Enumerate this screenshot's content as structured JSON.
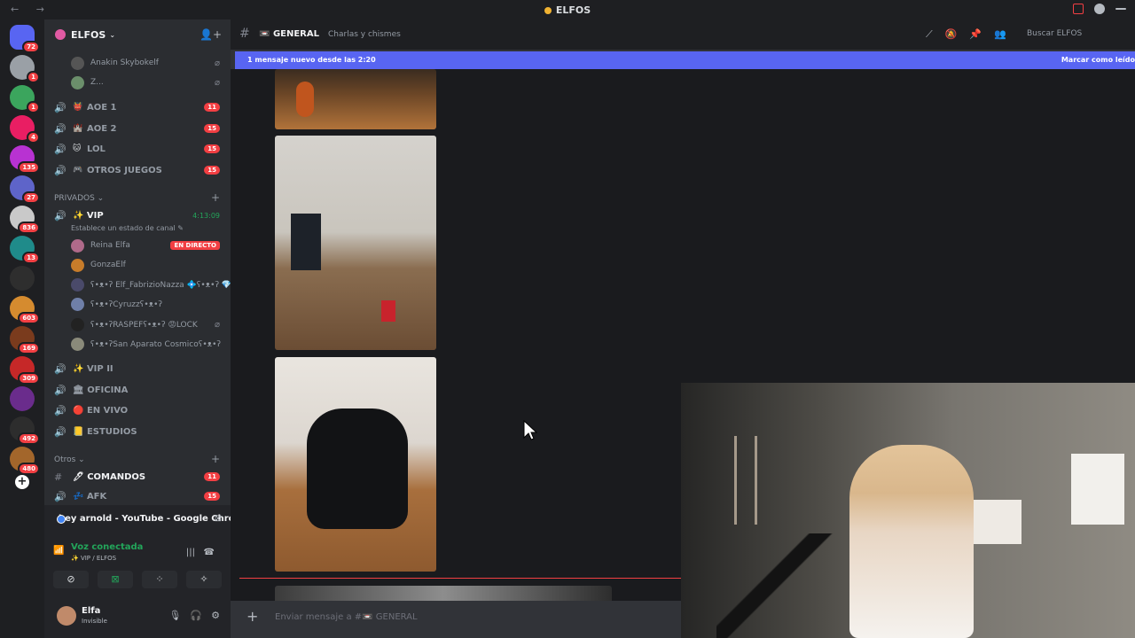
{
  "window": {
    "title": "ELFOS"
  },
  "guilds": [
    {
      "badge": "72",
      "color": "#5865f2"
    },
    {
      "badge": "1",
      "color": "#9aa0a6"
    },
    {
      "badge": "1",
      "color": "#3ba55d"
    },
    {
      "badge": "4",
      "color": "#e91e63"
    },
    {
      "badge": "135",
      "color": "#b832d2"
    },
    {
      "badge": "27",
      "color": "#5e64c9"
    },
    {
      "badge": "836",
      "color": "#c9c9c9"
    },
    {
      "badge": "13",
      "color": "#1f8b8a"
    },
    {
      "badge": "",
      "color": "#2e2e2e"
    },
    {
      "badge": "603",
      "color": "#d58b2f"
    },
    {
      "badge": "169",
      "color": "#7a3b1d"
    },
    {
      "badge": "309",
      "color": "#c62828"
    },
    {
      "badge": "",
      "color": "#6a2c8c"
    },
    {
      "badge": "492",
      "color": "#2d2d2d"
    },
    {
      "badge": "480",
      "color": "#a3662b"
    }
  ],
  "server": {
    "name": "ELFOS",
    "chevron": "⌄"
  },
  "top_users": [
    {
      "name": "Anakin Skybokelf",
      "color": "#555"
    },
    {
      "name": "Z...",
      "color": "#6b8f6b"
    }
  ],
  "voice_channels": [
    {
      "icon": "🔊",
      "emoji": "👹",
      "name": "AOE 1",
      "badge": "11"
    },
    {
      "icon": "🔊",
      "emoji": "🏰",
      "name": "AOE 2",
      "badge": "15"
    },
    {
      "icon": "🔊",
      "emoji": "🐱",
      "name": "LOL",
      "badge": "15"
    },
    {
      "icon": "🔊",
      "emoji": "🎮",
      "name": "OTROS JUEGOS",
      "badge": "15"
    }
  ],
  "privados": {
    "label": "PRIVADOS",
    "vip": {
      "name": "✨ VIP",
      "time": "4:13:09",
      "status": "Establece un estado de canal ✎"
    },
    "users": [
      {
        "name": "Reina Elfa",
        "color": "#b06a8a",
        "live": "EN DIRECTO"
      },
      {
        "name": "GonzaElf",
        "color": "#c77c2a",
        "live": ""
      },
      {
        "name": "ʕ•ᴥ•ʔ Elf_FabrizioNazza 💠ʕ•ᴥ•ʔ 💎",
        "color": "#4a4a6a",
        "live": ""
      },
      {
        "name": "ʕ•ᴥ•ʔCyruzzʕ•ᴥ•ʔ",
        "color": "#6f7fa8",
        "live": ""
      },
      {
        "name": "ʕ•ᴥ•ʔRASPEFʕ•ᴥ•ʔ 😡LOCK",
        "color": "#222",
        "live": ""
      },
      {
        "name": "ʕ•ᴥ•ʔSan Aparato Cosmicoʕ•ᴥ•ʔ",
        "color": "#8a8a7a",
        "live": ""
      }
    ],
    "channels": [
      {
        "emoji": "✨",
        "name": "VIP II"
      },
      {
        "emoji": "🏛",
        "name": "OFICINA"
      },
      {
        "emoji": "🔴",
        "name": "EN VIVO"
      },
      {
        "emoji": "📒",
        "name": "ESTUDIOS"
      }
    ]
  },
  "otros": {
    "label": "Otros",
    "channels": [
      {
        "name": "COMANDOS",
        "badge": "11",
        "emoji": "🖊"
      },
      {
        "name": "AFK",
        "badge": "15",
        "emoji": "💤"
      }
    ]
  },
  "activity": {
    "text": "hey arnold - YouTube - Google Chro..."
  },
  "voice": {
    "title": "Voz conectada",
    "sub": "✨ VIP / ELFOS"
  },
  "user": {
    "name": "Elfa",
    "status": "Invisible"
  },
  "channel": {
    "name": "GENERAL",
    "topic": "Charlas y chismes",
    "search_placeholder": "Buscar ELFOS"
  },
  "banner": {
    "text": "1 mensaje nuevo desde las 2:20",
    "action": "Marcar como leído"
  },
  "composer": {
    "placeholder": "Enviar mensaje a #📼 GENERAL"
  }
}
